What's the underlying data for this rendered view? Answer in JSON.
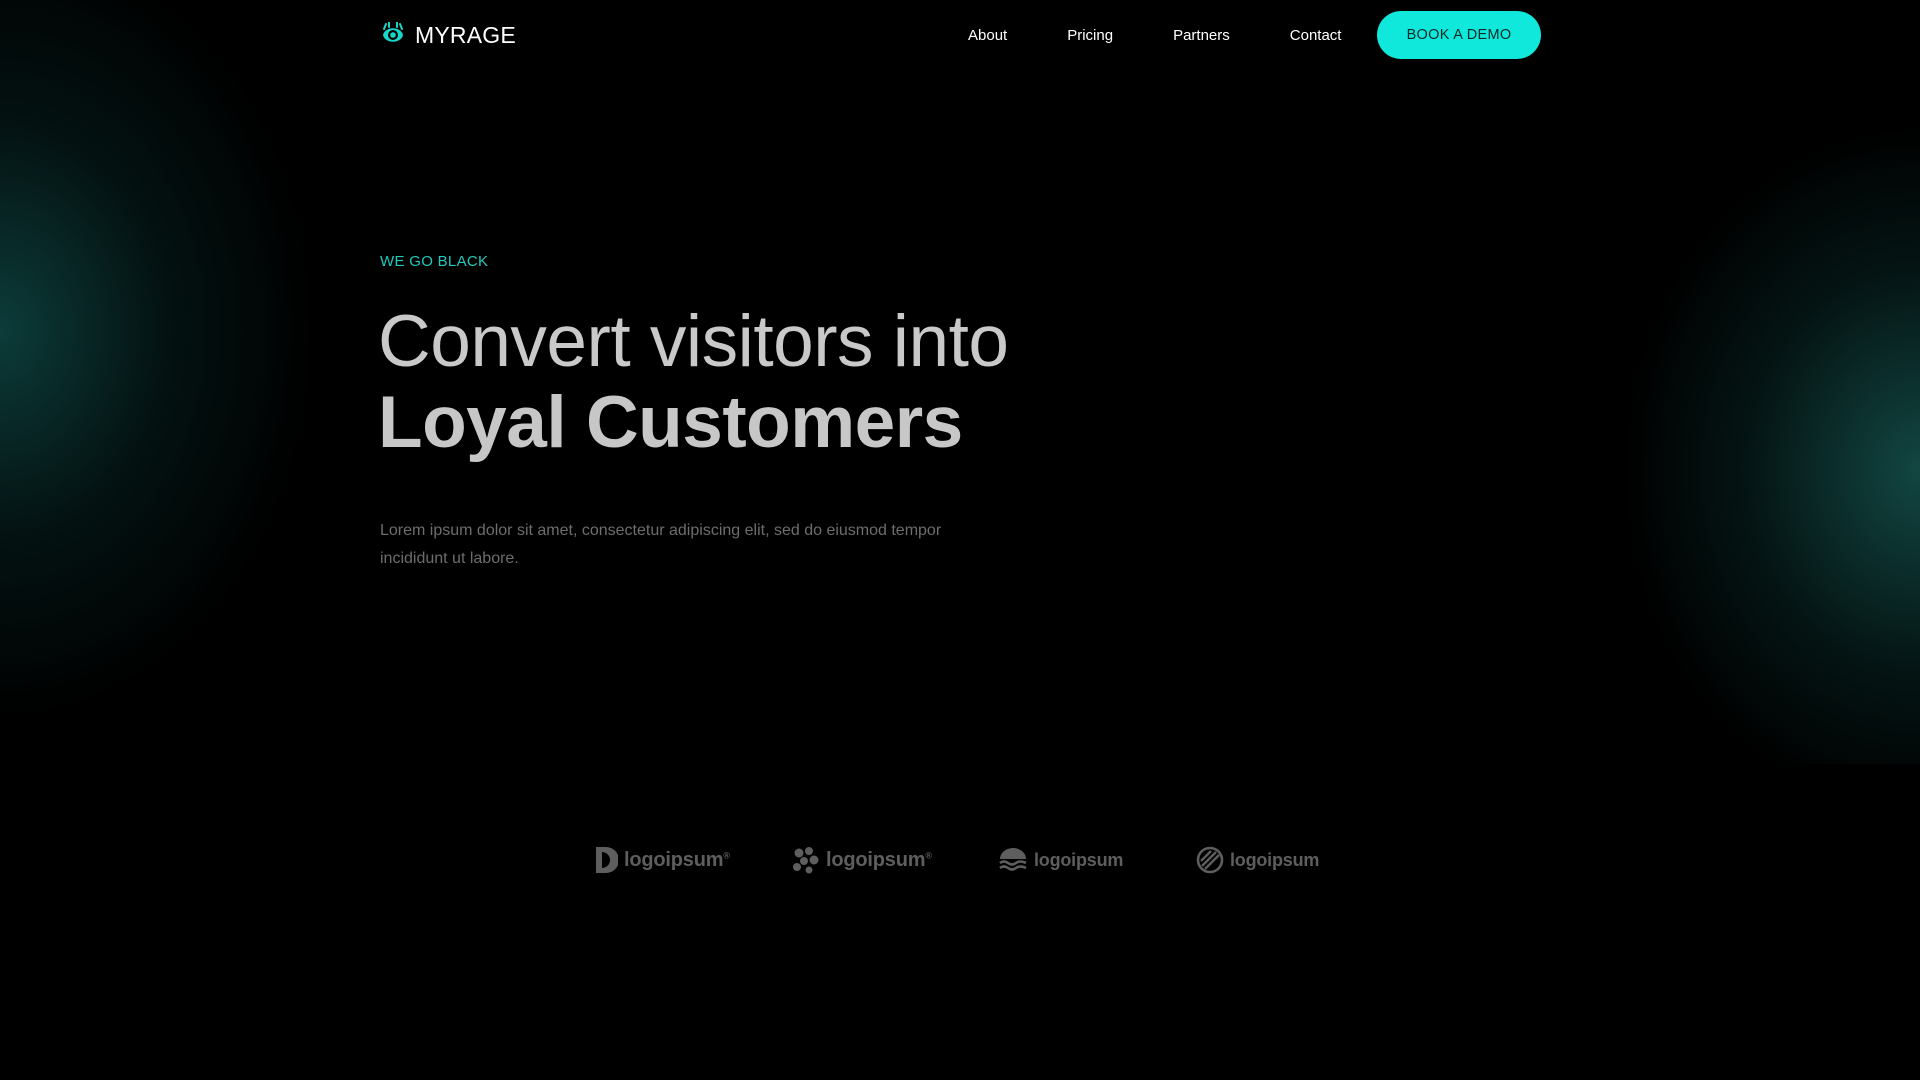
{
  "header": {
    "brand": "MYRAGE",
    "nav": [
      "About",
      "Pricing",
      "Partners",
      "Contact"
    ],
    "cta": "BOOK A DEMO"
  },
  "hero": {
    "eyebrow": "WE GO BLACK",
    "headline_line1": "Convert visitors into",
    "headline_line2": "Loyal Customers",
    "lede": "Lorem ipsum dolor sit amet, consectetur adipiscing elit, sed do eiusmod tempor incididunt ut labore."
  },
  "logos": [
    "logoipsum",
    "logoipsum",
    "logoipsum",
    "logoipsum"
  ],
  "colors": {
    "accent": "#0fe8da",
    "eyebrow": "#22c9bd",
    "background": "#000000",
    "glow": "#125c58"
  }
}
